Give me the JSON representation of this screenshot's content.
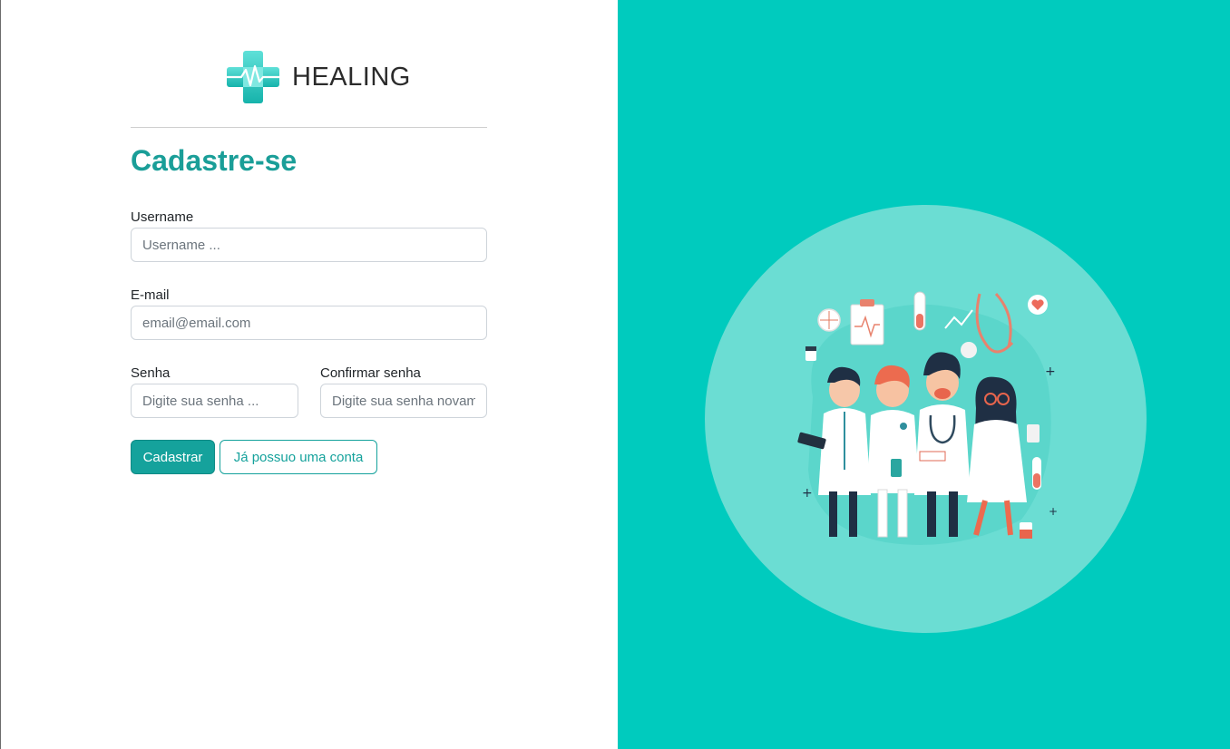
{
  "brand": {
    "name": "HEALING",
    "icon": "medical-cross-heartbeat-icon",
    "accent_color": "#15a29c"
  },
  "form": {
    "title": "Cadastre-se",
    "username": {
      "label": "Username",
      "placeholder": "Username ..."
    },
    "email": {
      "label": "E-mail",
      "placeholder": "email@email.com"
    },
    "password": {
      "label": "Senha",
      "placeholder": "Digite sua senha ..."
    },
    "confirm_password": {
      "label": "Confirmar senha",
      "placeholder": "Digite sua senha novamente ..."
    },
    "submit_label": "Cadastrar",
    "login_label": "Já possuo uma conta"
  },
  "hero": {
    "background_color": "#00cbbe",
    "circle_color": "#6bddd3",
    "illustration": "doctors-team-illustration"
  }
}
